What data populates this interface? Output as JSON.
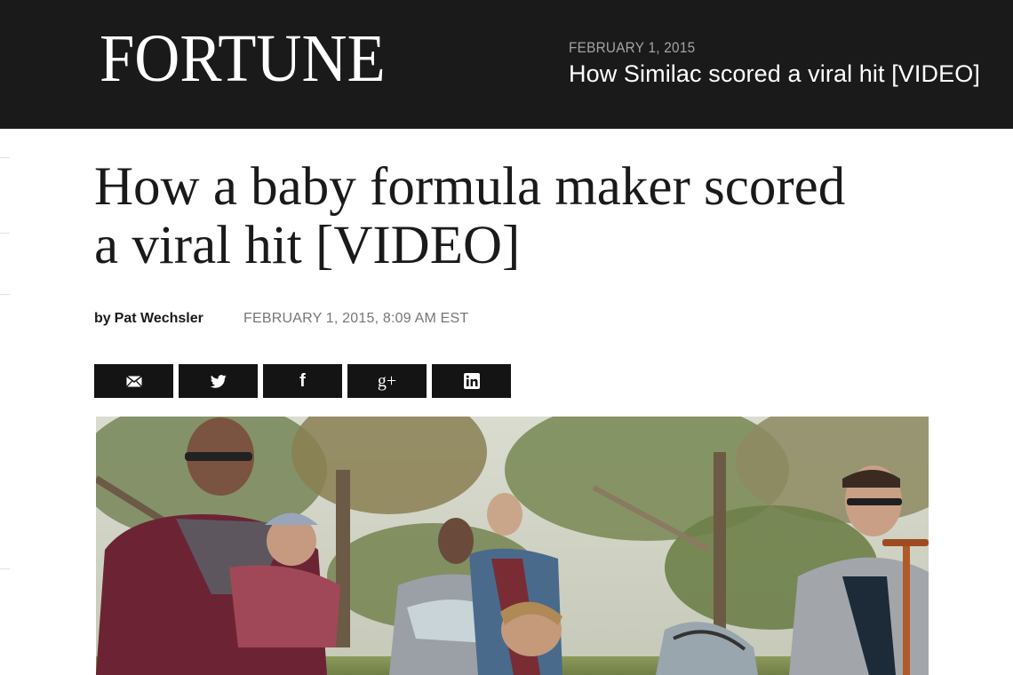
{
  "masthead": {
    "logo": "FORTUNE",
    "latest_date": "FEBRUARY 1, 2015",
    "latest_title": "How Similac scored a viral hit [VIDEO]"
  },
  "article": {
    "headline_line1": "How a baby formula maker scored",
    "headline_line2": "a viral hit [VIDEO]",
    "by": "by",
    "author": "Pat Wechsler",
    "date": "FEBRUARY 1, 2015, 8:09 AM EST"
  },
  "share": [
    {
      "icon": "email-icon"
    },
    {
      "icon": "twitter-icon"
    },
    {
      "icon": "facebook-icon",
      "glyph": "f"
    },
    {
      "icon": "google-plus-icon",
      "glyph": "g+"
    },
    {
      "icon": "linkedin-icon",
      "glyph": "in"
    }
  ],
  "colors": {
    "masthead_bg": "#1b1a1a",
    "share_bg": "#141414",
    "text": "#1a1a1a",
    "muted": "#777777"
  }
}
